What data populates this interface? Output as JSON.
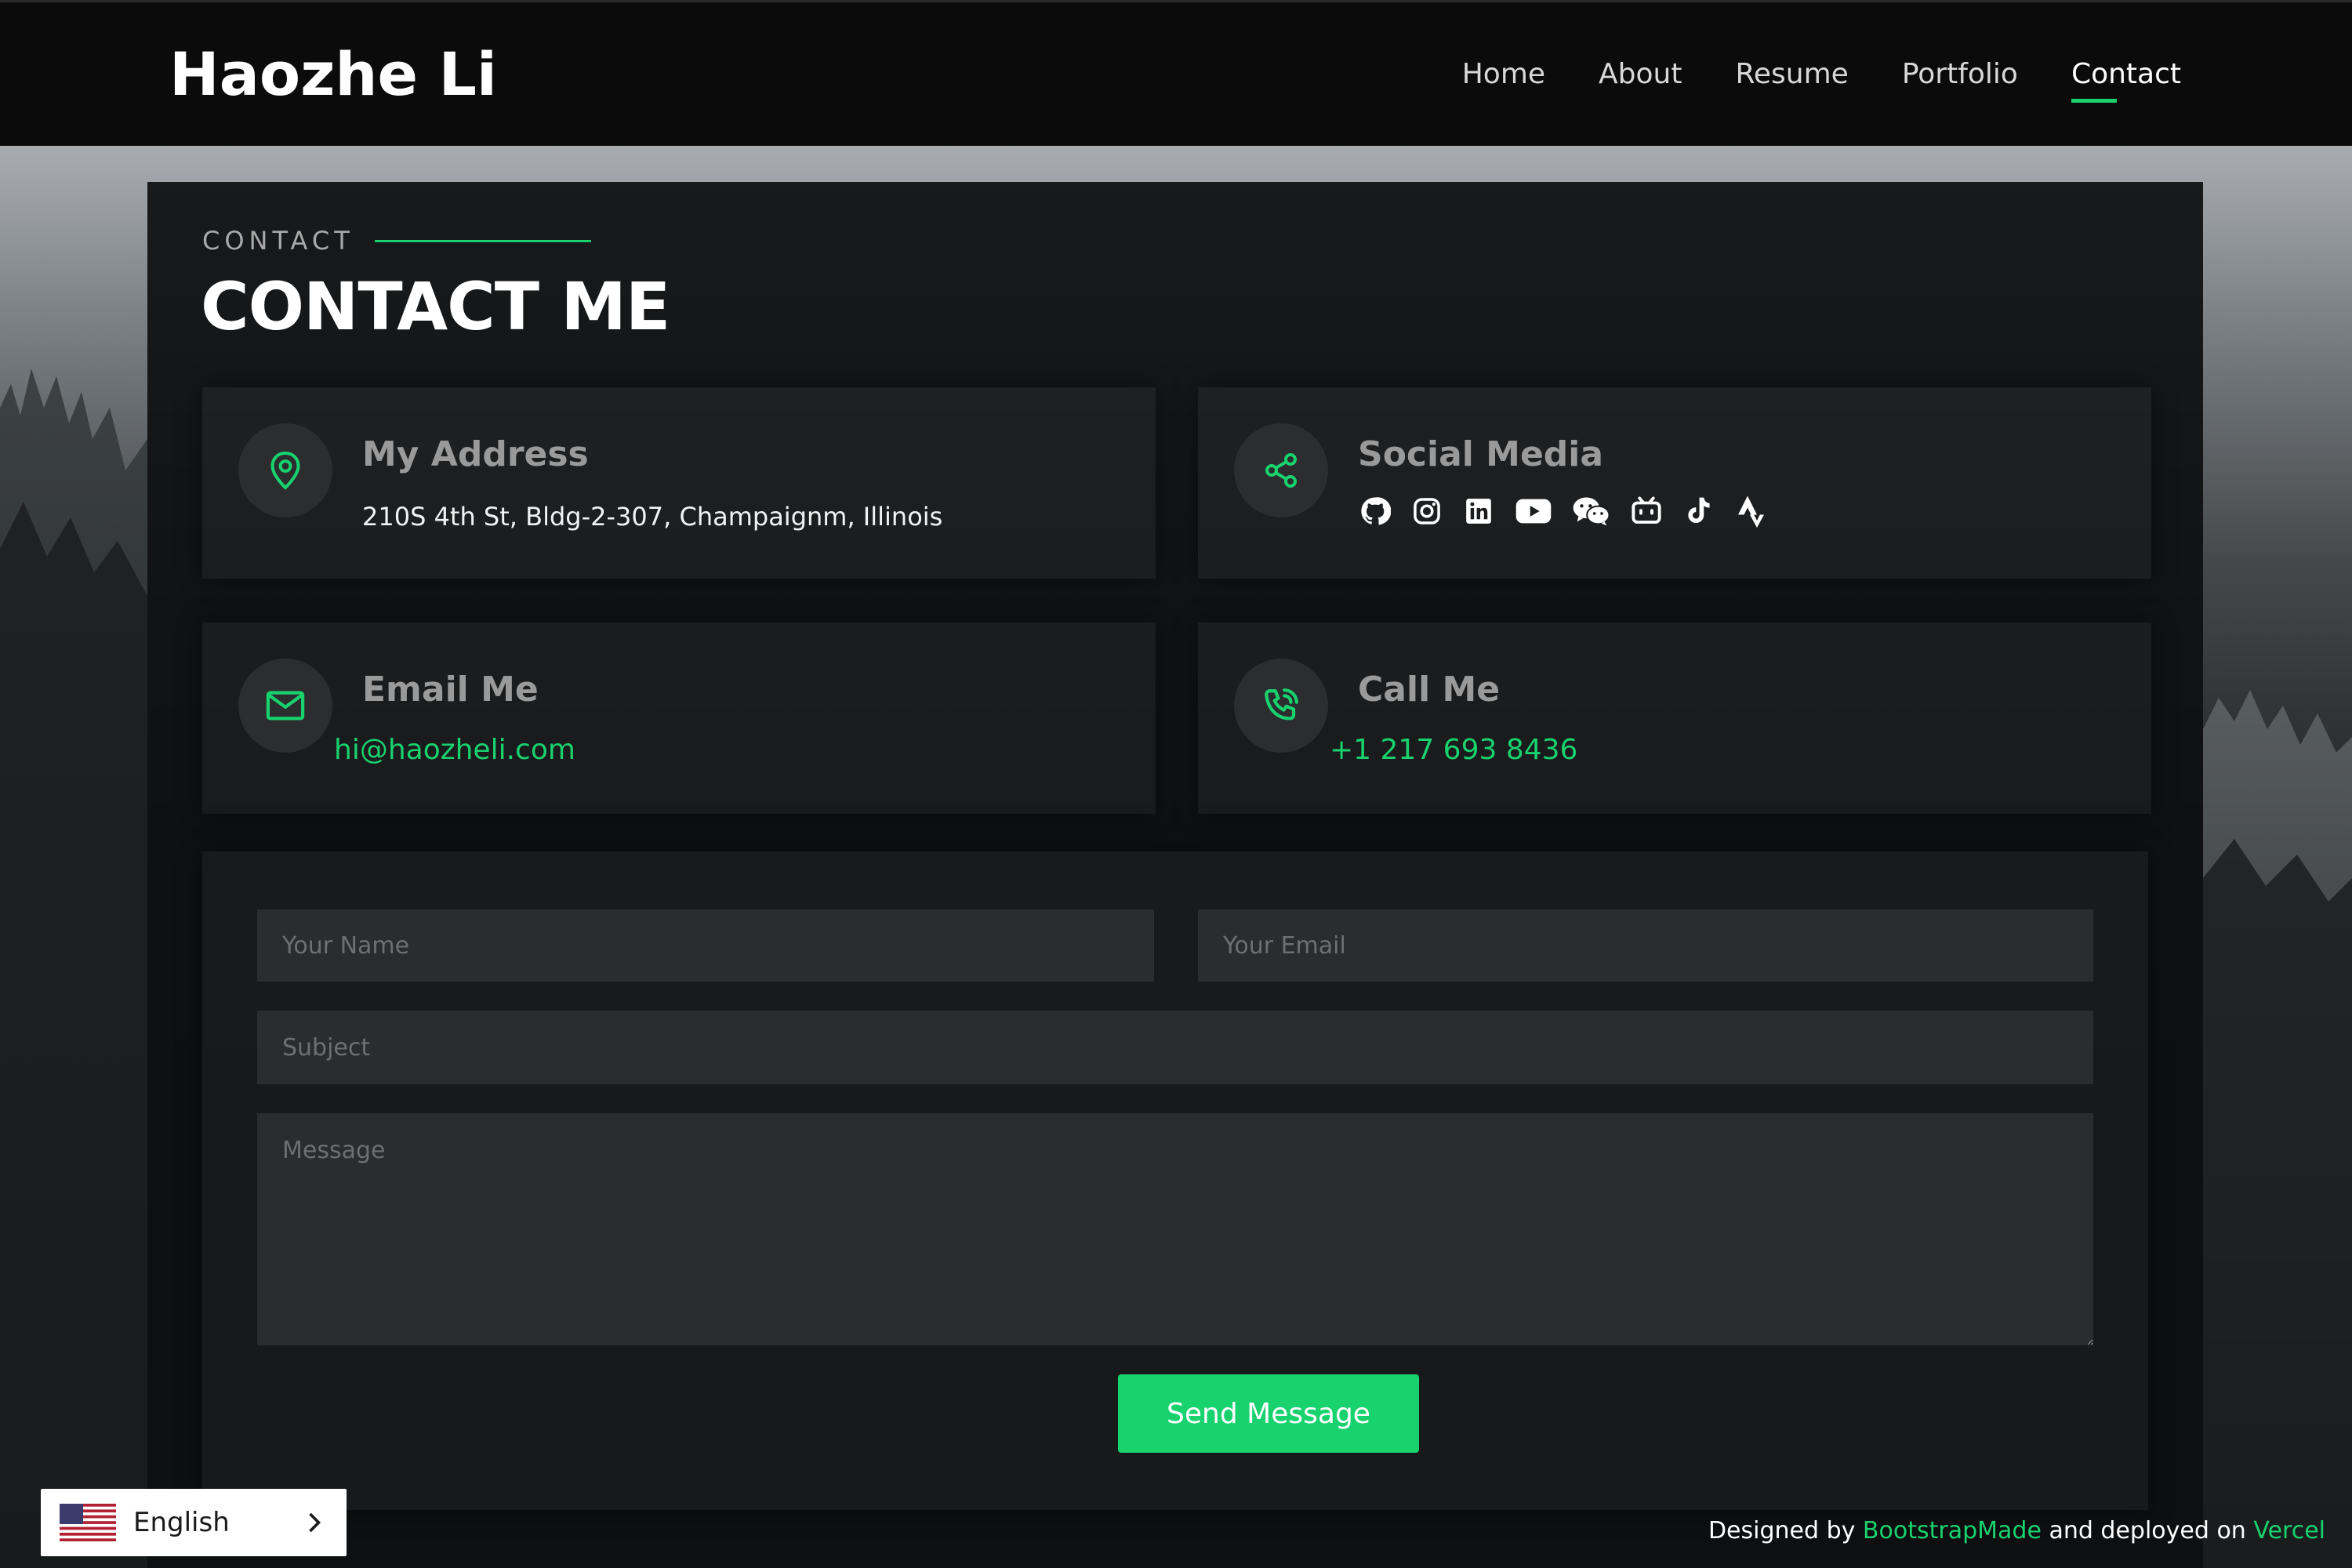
{
  "header": {
    "logo": "Haozhe Li",
    "nav": [
      {
        "label": "Home",
        "active": false
      },
      {
        "label": "About",
        "active": false
      },
      {
        "label": "Resume",
        "active": false
      },
      {
        "label": "Portfolio",
        "active": false
      },
      {
        "label": "Contact",
        "active": true
      }
    ]
  },
  "section": {
    "label": "CONTACT",
    "title": "CONTACT ME"
  },
  "cards": {
    "address": {
      "title": "My Address",
      "text": "210S 4th St, Bldg-2-307, Champaignm, Illinois",
      "icon": "map-pin-icon"
    },
    "social": {
      "title": "Social Media",
      "icon": "share-icon",
      "links": [
        "github-icon",
        "instagram-icon",
        "linkedin-icon",
        "youtube-icon",
        "wechat-icon",
        "bilibili-icon",
        "tiktok-icon",
        "strava-icon"
      ]
    },
    "email": {
      "title": "Email Me",
      "text": "hi@haozheli.com",
      "icon": "envelope-icon"
    },
    "phone": {
      "title": "Call Me",
      "text": "+1 217 693 8436",
      "icon": "phone-icon"
    }
  },
  "form": {
    "name_placeholder": "Your Name",
    "email_placeholder": "Your Email",
    "subject_placeholder": "Subject",
    "message_placeholder": "Message",
    "submit_label": "Send Message"
  },
  "credits": {
    "prefix": "Designed by",
    "designer": "BootstrapMade",
    "middle": "and deployed on",
    "host": "Vercel"
  },
  "language": {
    "label": "English",
    "flag_icon": "us-flag-icon"
  },
  "colors": {
    "accent": "#18d26e",
    "header_bg": "#0b0b0c",
    "panel_bg": "#0e0f10"
  }
}
